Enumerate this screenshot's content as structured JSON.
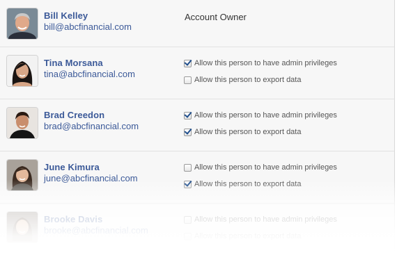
{
  "users": [
    {
      "name": "Bill Kelley",
      "email": "bill@abcfinancial.com",
      "role": "Account Owner",
      "avatar_icon": "avatar-photo-man-gray-hair"
    },
    {
      "name": "Tina Morsana",
      "email": "tina@abcfinancial.com",
      "avatar_icon": "avatar-photo-woman-dark-hair",
      "permissions": [
        {
          "label": "Allow this person to have admin privileges",
          "checked": true
        },
        {
          "label": "Allow this person to export data",
          "checked": false
        }
      ]
    },
    {
      "name": "Brad Creedon",
      "email": "brad@abcfinancial.com",
      "avatar_icon": "avatar-photo-man-dark-hair",
      "permissions": [
        {
          "label": "Allow this person to have admin privileges",
          "checked": true
        },
        {
          "label": "Allow this person to export data",
          "checked": true
        }
      ]
    },
    {
      "name": "June Kimura",
      "email": "june@abcfinancial.com",
      "avatar_icon": "avatar-photo-woman-dark-hair",
      "permissions": [
        {
          "label": "Allow this person to have admin privileges",
          "checked": false
        },
        {
          "label": "Allow this person to export data",
          "checked": true
        }
      ]
    },
    {
      "name": "Brooke Davis",
      "email": "brooke@abcfinancial.com",
      "avatar_icon": "avatar-photo-woman-light-hair",
      "permissions": [
        {
          "label": "Allow this person to have admin privileges",
          "checked": false
        },
        {
          "label": "Allow this person to export data",
          "checked": false
        }
      ]
    }
  ],
  "colors": {
    "name_link": "#3b5998",
    "panel_bg": "#f7f7f7",
    "checkmark": "#1f4e8c"
  }
}
